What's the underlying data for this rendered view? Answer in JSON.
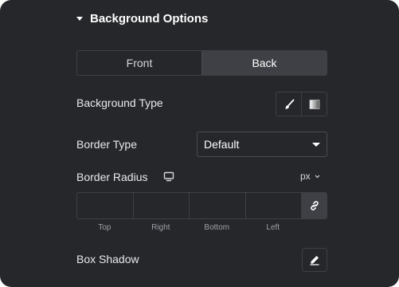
{
  "section": {
    "title": "Background Options"
  },
  "side_toggle": {
    "front_label": "Front",
    "back_label": "Back",
    "selected": "Back"
  },
  "background_type": {
    "label": "Background Type",
    "options": [
      "classic-brush-icon",
      "gradient-icon"
    ],
    "selected": "classic-brush-icon"
  },
  "border_type": {
    "label": "Border Type",
    "value": "Default"
  },
  "border_radius": {
    "label": "Border Radius",
    "unit": "px",
    "fields": {
      "top": "",
      "right": "",
      "bottom": "",
      "left": ""
    },
    "field_labels": {
      "top": "Top",
      "right": "Right",
      "bottom": "Bottom",
      "left": "Left"
    }
  },
  "box_shadow": {
    "label": "Box Shadow"
  },
  "colors": {
    "panel_bg": "#26272b",
    "control_bg": "#3f4045",
    "text": "#e8e9eb",
    "muted": "#9da0a6"
  }
}
